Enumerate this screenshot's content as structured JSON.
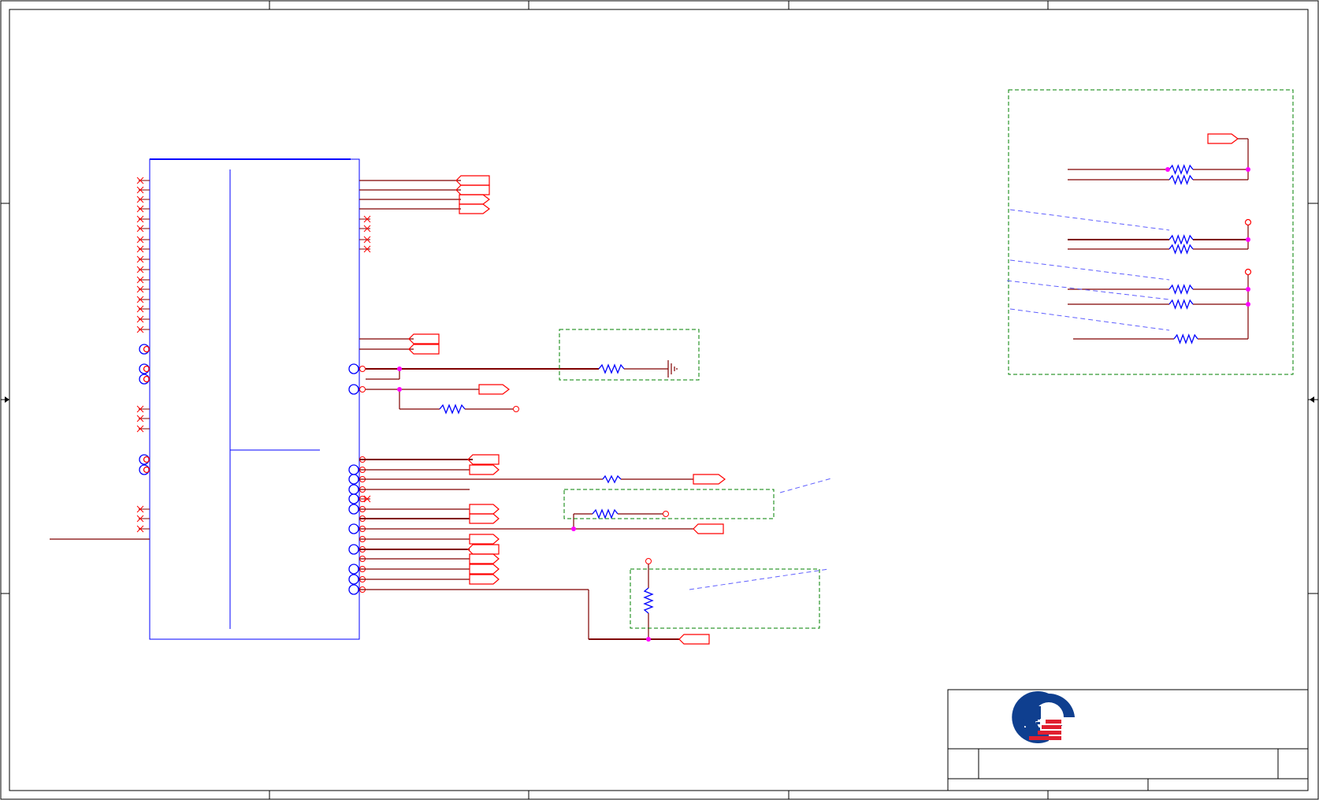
{
  "drawing": {
    "kind": "schematic-sheet",
    "colors": {
      "border": "#000000",
      "part_outline": "#0000ff",
      "wire": "#800000",
      "net_symbol": "#ff0000",
      "junction": "#ff00ff",
      "note_box": "#008000",
      "pointer_line": "#6060ff",
      "logo_blue": "#0f3f8f",
      "logo_red": "#e02030"
    },
    "logo": {
      "name": "company-logo"
    },
    "title_block": {
      "title": "",
      "sheet": "",
      "rev": "",
      "date": ""
    }
  }
}
